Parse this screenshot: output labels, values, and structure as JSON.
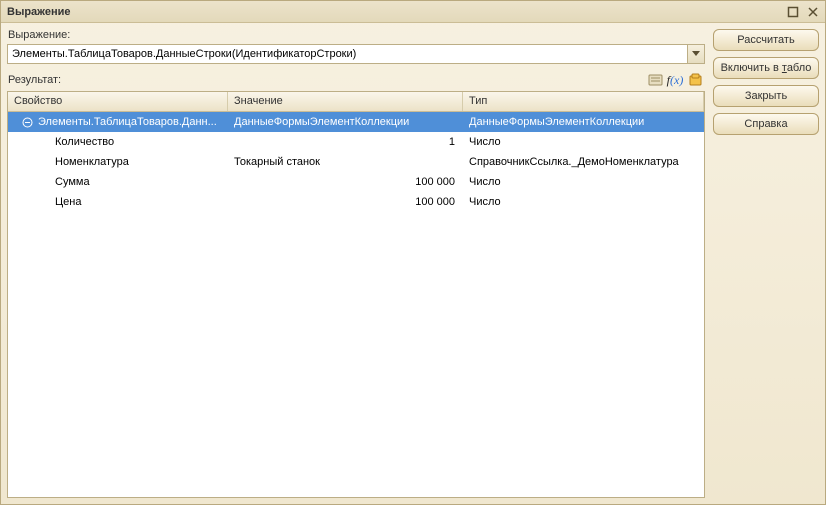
{
  "window": {
    "title": "Выражение"
  },
  "expr": {
    "label": "Выражение:",
    "value": "Элементы.ТаблицаТоваров.ДанныеСтроки(ИдентификаторСтроки)"
  },
  "result": {
    "label": "Результат:"
  },
  "grid": {
    "headers": {
      "property": "Свойство",
      "value": "Значение",
      "type": "Тип"
    },
    "rows": [
      {
        "property": "Элементы.ТаблицаТоваров.Данн...",
        "value": "ДанныеФормыЭлементКоллекции",
        "type": "ДанныеФормыЭлементКоллекции",
        "selected": true,
        "expandable": true,
        "valAlign": "left"
      },
      {
        "property": "Количество",
        "value": "1",
        "type": "Число"
      },
      {
        "property": "Номенклатура",
        "value": "Токарный станок",
        "type": "СправочникСсылка._ДемоНоменклатура",
        "valAlign": "left"
      },
      {
        "property": "Сумма",
        "value": "100 000",
        "type": "Число"
      },
      {
        "property": "Цена",
        "value": "100 000",
        "type": "Число"
      }
    ]
  },
  "buttons": {
    "calculate": "Рассчитать",
    "toTable_prefix": "Включить в ",
    "toTable_underline": "т",
    "toTable_suffix": "абло",
    "close": "Закрыть",
    "help": "Справка"
  }
}
